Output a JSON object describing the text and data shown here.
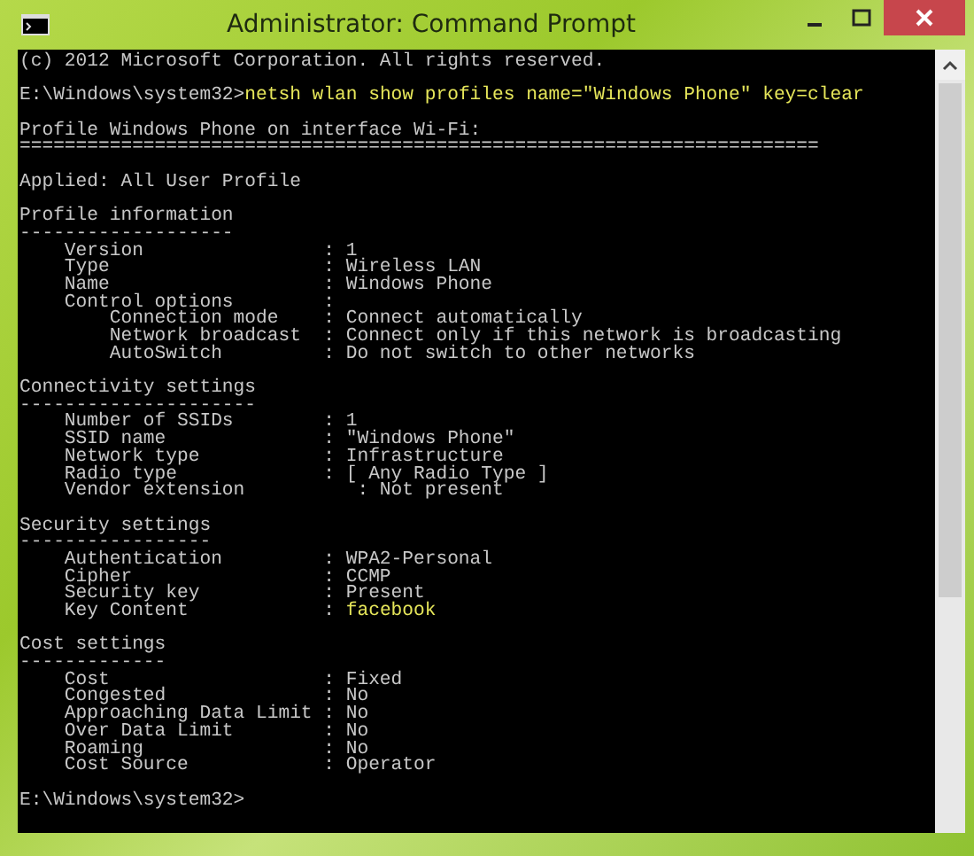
{
  "window": {
    "title": "Administrator: Command Prompt"
  },
  "console": {
    "blocks": [
      {
        "kind": "text",
        "lines": [
          {
            "text": "(c) 2012 Microsoft Corporation. All rights reserved."
          }
        ]
      },
      {
        "kind": "text",
        "lines": [
          {
            "text": "E:\\Windows\\system32>",
            "highlight": "netsh wlan show profiles name=\"Windows Phone\" key=clear"
          }
        ]
      },
      {
        "kind": "text",
        "lines": [
          {
            "text": "Profile Windows Phone on interface Wi-Fi:"
          },
          {
            "text": "======================================================================="
          }
        ]
      },
      {
        "kind": "text",
        "lines": [
          {
            "text": "Applied: All User Profile"
          }
        ]
      },
      {
        "kind": "text",
        "lines": [
          {
            "text": "Profile information"
          },
          {
            "text": "-------------------"
          },
          {
            "text": "    Version                : 1"
          },
          {
            "text": "    Type                   : Wireless LAN"
          },
          {
            "text": "    Name                   : Windows Phone"
          },
          {
            "text": "    Control options        :"
          },
          {
            "text": "        Connection mode    : Connect automatically"
          },
          {
            "text": "        Network broadcast  : Connect only if this network is broadcasting"
          },
          {
            "text": "        AutoSwitch         : Do not switch to other networks"
          }
        ]
      },
      {
        "kind": "text",
        "lines": [
          {
            "text": "Connectivity settings"
          },
          {
            "text": "---------------------"
          },
          {
            "text": "    Number of SSIDs        : 1"
          },
          {
            "text": "    SSID name              : \"Windows Phone\""
          },
          {
            "text": "    Network type           : Infrastructure"
          },
          {
            "text": "    Radio type             : [ Any Radio Type ]"
          },
          {
            "text": "    Vendor extension          : Not present"
          }
        ]
      },
      {
        "kind": "text",
        "lines": [
          {
            "text": "Security settings"
          },
          {
            "text": "-----------------"
          },
          {
            "text": "    Authentication         : WPA2-Personal"
          },
          {
            "text": "    Cipher                 : CCMP"
          },
          {
            "text": "    Security key           : Present"
          },
          {
            "text": "    Key Content            : ",
            "highlight": "facebook"
          }
        ]
      },
      {
        "kind": "text",
        "lines": [
          {
            "text": "Cost settings"
          },
          {
            "text": "-------------"
          },
          {
            "text": "    Cost                   : Fixed"
          },
          {
            "text": "    Congested              : No"
          },
          {
            "text": "    Approaching Data Limit : No"
          },
          {
            "text": "    Over Data Limit        : No"
          },
          {
            "text": "    Roaming                : No"
          },
          {
            "text": "    Cost Source            : Operator"
          }
        ]
      },
      {
        "kind": "trailing",
        "lines": [
          {
            "text": "E:\\Windows\\system32>"
          }
        ]
      }
    ]
  }
}
